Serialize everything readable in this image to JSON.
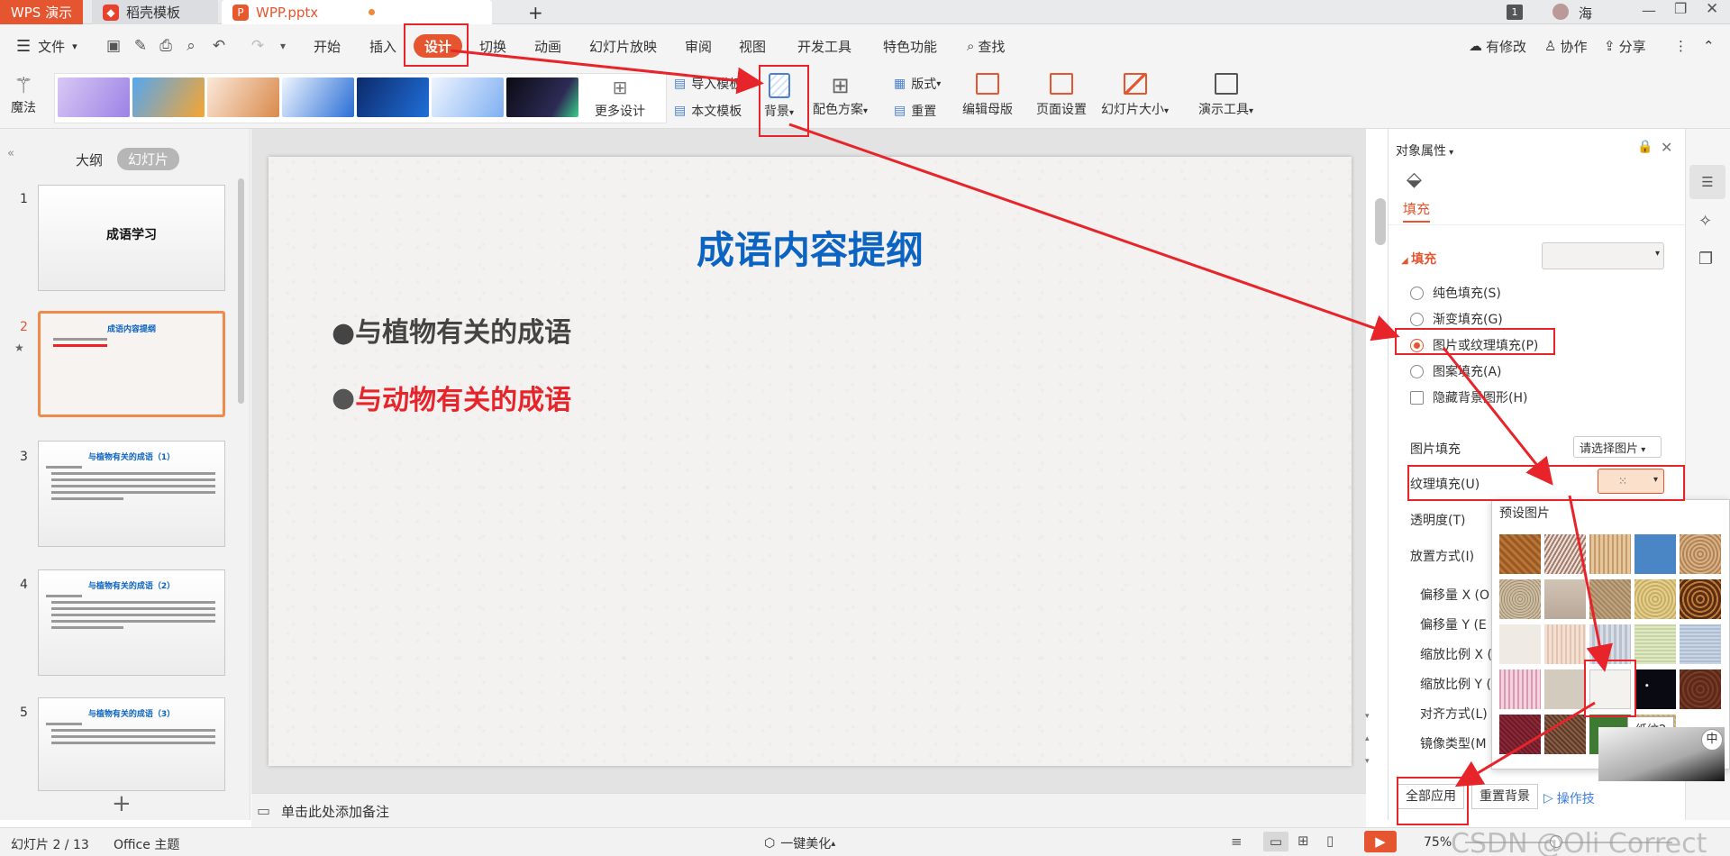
{
  "titlebar": {
    "app_tab": "WPS 演示",
    "tab2": "稻壳模板",
    "tab3": "WPP.pptx",
    "new_tab": "+",
    "badge": "1",
    "user": "海"
  },
  "menu": {
    "file": "文件",
    "items": [
      "开始",
      "插入",
      "设计",
      "切换",
      "动画",
      "幻灯片放映",
      "审阅",
      "视图",
      "开发工具",
      "特色功能"
    ],
    "search": "查找",
    "changes": "有修改",
    "collab": "协作",
    "share": "分享"
  },
  "ribbon": {
    "magic": "魔法",
    "more_design": "更多设计",
    "import_template": "导入模板",
    "body_template": "本文模板",
    "background": "背景",
    "color_scheme": "配色方案",
    "layout": "版式",
    "reset": "重置",
    "edit_master": "编辑母版",
    "page_setup": "页面设置",
    "slide_size": "幻灯片大小",
    "present_tools": "演示工具"
  },
  "leftpane": {
    "outline_tab": "大纲",
    "slides_tab": "幻灯片",
    "slides": [
      {
        "num": "1",
        "title": "成语学习"
      },
      {
        "num": "2",
        "title": "成语内容提纲"
      },
      {
        "num": "3",
        "title": "与植物有关的成语（1）"
      },
      {
        "num": "4",
        "title": "与植物有关的成语（2）"
      },
      {
        "num": "5",
        "title": "与植物有关的成语（3）"
      }
    ],
    "add": "+"
  },
  "slide": {
    "title": "成语内容提纲",
    "bullet1": "●与植物有关的成语",
    "bullet2": "与动物有关的成语"
  },
  "notes": "单击此处添加备注",
  "panel": {
    "title": "对象属性",
    "tab": "填充",
    "section": "填充",
    "solid": "纯色填充(S)",
    "gradient": "渐变填充(G)",
    "picture_texture": "图片或纹理填充(P)",
    "pattern": "图案填充(A)",
    "hide_bg": "隐藏背景图形(H)",
    "picture_fill": "图片填充",
    "choose_picture": "请选择图片",
    "texture_fill": "纹理填充(U)",
    "transparency": "透明度(T)",
    "placement": "放置方式(I)",
    "offset_x": "偏移量 X (O",
    "offset_y": "偏移量 Y (E",
    "scale_x": "缩放比例 X (",
    "scale_y": "缩放比例 Y (",
    "align": "对齐方式(L)",
    "mirror": "镜像类型(M",
    "apply_all": "全部应用",
    "reset_bg": "重置背景",
    "tips": "操作技"
  },
  "popup": {
    "title": "预设图片",
    "tooltip": "纸纹2"
  },
  "status": {
    "slide_count": "幻灯片 2 / 13",
    "theme": "Office 主题",
    "beautify": "一键美化",
    "zoom": "75%",
    "watermark": "CSDN @Oli Correct"
  },
  "colors": {
    "accent": "#e5552f",
    "design_tab": "#e5552f",
    "title_blue": "#0b63c2",
    "annotation_red": "#e8242b"
  }
}
